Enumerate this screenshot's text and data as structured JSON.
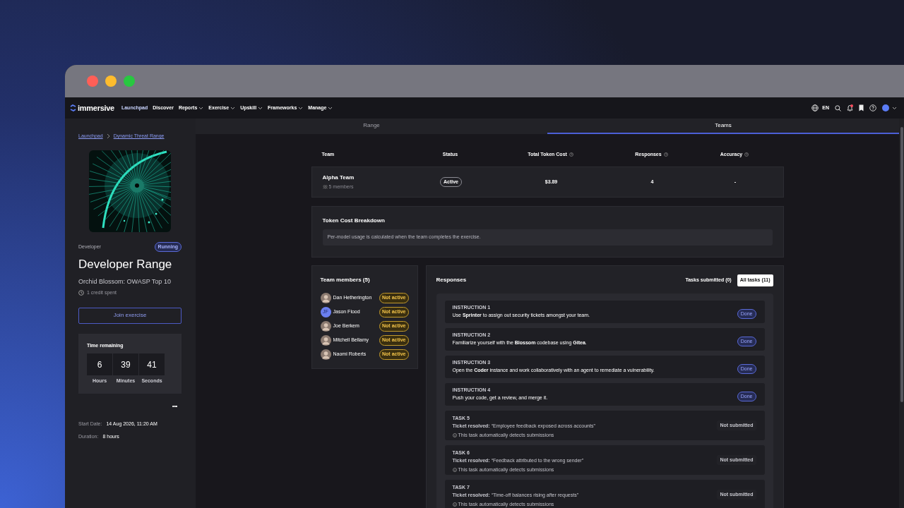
{
  "nav": {
    "brand": "immersive",
    "items": [
      {
        "label": "Launchpad",
        "has_menu": false
      },
      {
        "label": "Discover",
        "has_menu": false
      },
      {
        "label": "Reports",
        "has_menu": true
      },
      {
        "label": "Exercise",
        "has_menu": true
      },
      {
        "label": "Upskill",
        "has_menu": true
      },
      {
        "label": "Frameworks",
        "has_menu": true
      },
      {
        "label": "Manage",
        "has_menu": true
      }
    ],
    "language": "EN",
    "notifications_unread": true
  },
  "view_tabs": [
    {
      "label": "Range",
      "selected": false
    },
    {
      "label": "Teams",
      "selected": true
    }
  ],
  "sidebar": {
    "breadcrumb": [
      "Launchpad",
      "Dynamic Threat Range"
    ],
    "category": "Developer",
    "status": "Running",
    "title": "Developer Range",
    "subtitle": "Orchid Blossom: OWASP Top 10",
    "credits": "1 credit spent",
    "join_button": "Join exercise",
    "timer": {
      "title": "Time remaining",
      "units": [
        {
          "value": "6",
          "label": "Hours"
        },
        {
          "value": "39",
          "label": "Minutes"
        },
        {
          "value": "41",
          "label": "Seconds"
        }
      ]
    },
    "more": "•••",
    "details": [
      {
        "label": "Start Date:",
        "value": "14 Aug 2026, 11:20 AM"
      },
      {
        "label": "Duration:",
        "value": "8 hours"
      }
    ]
  },
  "teams_table": {
    "columns": [
      {
        "label": "Team",
        "has_help": false
      },
      {
        "label": "Status",
        "has_help": false
      },
      {
        "label": "Total Token Cost",
        "has_help": true
      },
      {
        "label": "Responses",
        "has_help": true
      },
      {
        "label": "Accuracy",
        "has_help": true
      }
    ],
    "rows": [
      {
        "name": "Alpha Team",
        "members": "5 members",
        "status": "Active",
        "cost": "$3.89",
        "responses": "4",
        "accuracy": "-"
      }
    ]
  },
  "token_breakdown": {
    "title": "Token Cost Breakdown",
    "note": "Per-model usage is calculated when the team completes the exercise."
  },
  "team_members": {
    "title": "Team members (5)",
    "members": [
      {
        "name": "Dan Hetherington",
        "status": "Not active",
        "active": false
      },
      {
        "name": "Jason Flood",
        "avatar": {
          "kind": "initials",
          "initials": "JF"
        },
        "status": "Not active",
        "active": false
      },
      {
        "name": "Joe Berkem",
        "status": "Not active",
        "active": false
      },
      {
        "name": "Mitchell Bellamy",
        "status": "Not active",
        "active": false
      },
      {
        "name": "Naomi Roberts",
        "status": "Not active",
        "active": false
      }
    ]
  },
  "responses": {
    "title": "Responses",
    "filters": [
      {
        "label": "Tasks submitted (0)",
        "selected": false
      },
      {
        "label": "All tasks (11)",
        "selected": true
      }
    ],
    "items": [
      {
        "kind": "instruction",
        "label": "INSTRUCTION 1",
        "text": "Use **Sprinter** to assign out security tickets amongst your team.",
        "status": "Done"
      },
      {
        "kind": "instruction",
        "label": "INSTRUCTION 2",
        "text": "Familiarize yourself with the **Blossom** codebase using **Gitea**.",
        "status": "Done"
      },
      {
        "kind": "instruction",
        "label": "INSTRUCTION 3",
        "text": "Open the **Coder** instance and work collaboratively with an agent to remediate a vulnerability.",
        "status": "Done"
      },
      {
        "kind": "instruction",
        "label": "INSTRUCTION 4",
        "text": "Push your code, get a review, and merge it.",
        "status": "Done"
      },
      {
        "kind": "task",
        "label": "TASK 5",
        "text": "**Ticket resolved:** “Employee feedback exposed across accounts”",
        "note": "This task automatically detects submissions",
        "status": "Not submitted"
      },
      {
        "kind": "task",
        "label": "TASK 6",
        "text": "**Ticket resolved:** “Feedback attributed to the wrong sender”",
        "note": "This task automatically detects submissions",
        "status": "Not submitted"
      },
      {
        "kind": "task",
        "label": "TASK 7",
        "text": "**Ticket resolved:** “Time-off balances rising after requests”",
        "note": "This task automatically detects submissions",
        "status": "Not submitted"
      }
    ]
  }
}
